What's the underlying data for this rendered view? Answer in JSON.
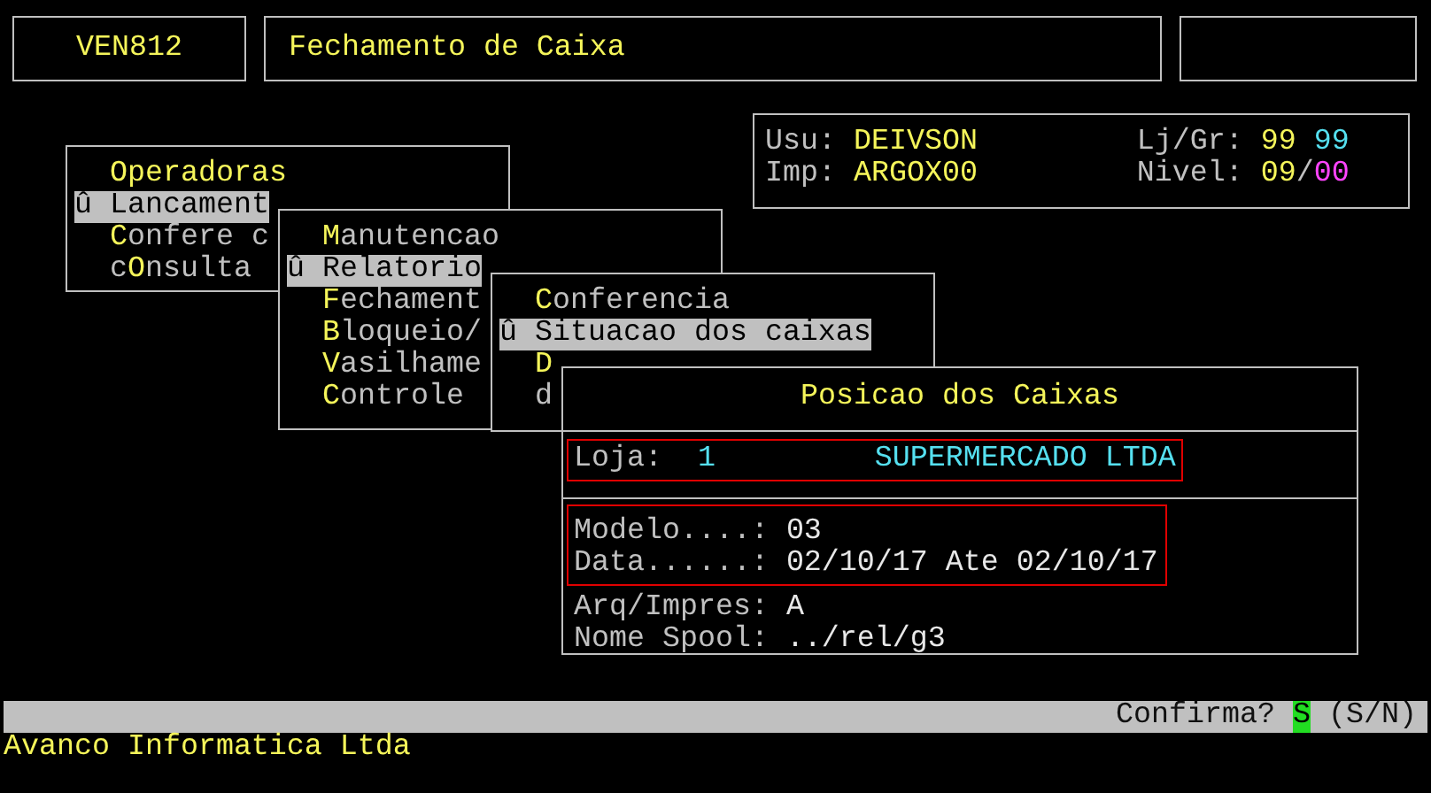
{
  "header": {
    "code": "VEN812",
    "title": "Fechamento de Caixa"
  },
  "session": {
    "user_label": "Usu:",
    "user": "DEIVSON",
    "store_group_label": "Lj/Gr:",
    "store": "99",
    "group": "99",
    "printer_label": "Imp:",
    "printer": "ARGOX00",
    "level_label": "Nivel:",
    "level_a": "09",
    "level_sep": "/",
    "level_b": "00"
  },
  "menus": [
    {
      "selected_marker": "û",
      "items": [
        {
          "key": "Operadoras",
          "selected": false
        },
        {
          "key": "L",
          "after": "ancament",
          "selected": true
        },
        {
          "key": "C",
          "after": "onfere c",
          "selected": false
        },
        {
          "before": "c",
          "key": "O",
          "after": "nsulta",
          "selected": false
        }
      ]
    },
    {
      "selected_marker": "û",
      "items": [
        {
          "key": "M",
          "after": "anutencao",
          "selected": false
        },
        {
          "key": "R",
          "after": "elatorio",
          "selected": true
        },
        {
          "key": "F",
          "after": "echament",
          "selected": false
        },
        {
          "key": "B",
          "after": "loqueio/",
          "selected": false
        },
        {
          "key": "V",
          "after": "asilhame",
          "selected": false
        },
        {
          "key": "C",
          "after": "ontrole",
          "selected": false
        }
      ]
    },
    {
      "selected_marker": "û",
      "items": [
        {
          "key": "C",
          "after": "onferencia",
          "selected": false
        },
        {
          "key": "S",
          "after": "ituacao dos caixas",
          "selected": true
        },
        {
          "key": "D",
          "selected": false
        },
        {
          "before": "d",
          "selected": false
        }
      ]
    }
  ],
  "dialog": {
    "title": "Posicao dos Caixas",
    "store": {
      "label": "Loja:",
      "number": "1",
      "name": "SUPERMERCADO LTDA",
      "framed": true
    },
    "fields": [
      {
        "label": "Modelo....:",
        "value": "03",
        "framed": true
      },
      {
        "label": "Data......:",
        "value": "02/10/17 Ate 02/10/17",
        "framed": true
      },
      {
        "label": "Arq/Impres:",
        "value": "A",
        "framed": false
      },
      {
        "label": "Nome Spool:",
        "value": "../rel/g3",
        "framed": false
      }
    ]
  },
  "status": {
    "prompt": "Confirma?",
    "answer": "S",
    "options": "(S/N)"
  },
  "footer": "Avanco Informatica Ltda"
}
